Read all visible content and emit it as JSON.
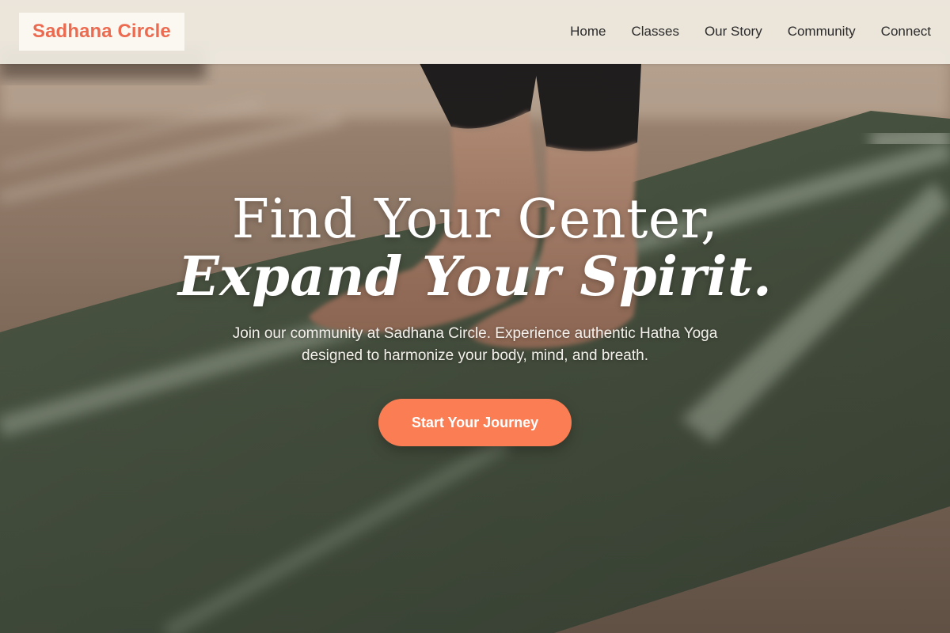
{
  "brand": {
    "name": "Sadhana Circle",
    "accent_color": "#ec6a4f"
  },
  "nav": {
    "items": [
      {
        "label": "Home"
      },
      {
        "label": "Classes"
      },
      {
        "label": "Our Story"
      },
      {
        "label": "Community"
      },
      {
        "label": "Connect"
      }
    ]
  },
  "hero": {
    "headline_line1": "Find Your Center,",
    "headline_line2": "Expand Your Spirit.",
    "subtitle": "Join our community at Sadhana Circle. Experience authentic Hatha Yoga designed to harmonize your body, mind, and breath.",
    "cta_label": "Start Your Journey",
    "cta_color": "#fb7d53",
    "background_image": "yoga-mat-feet-photo"
  }
}
